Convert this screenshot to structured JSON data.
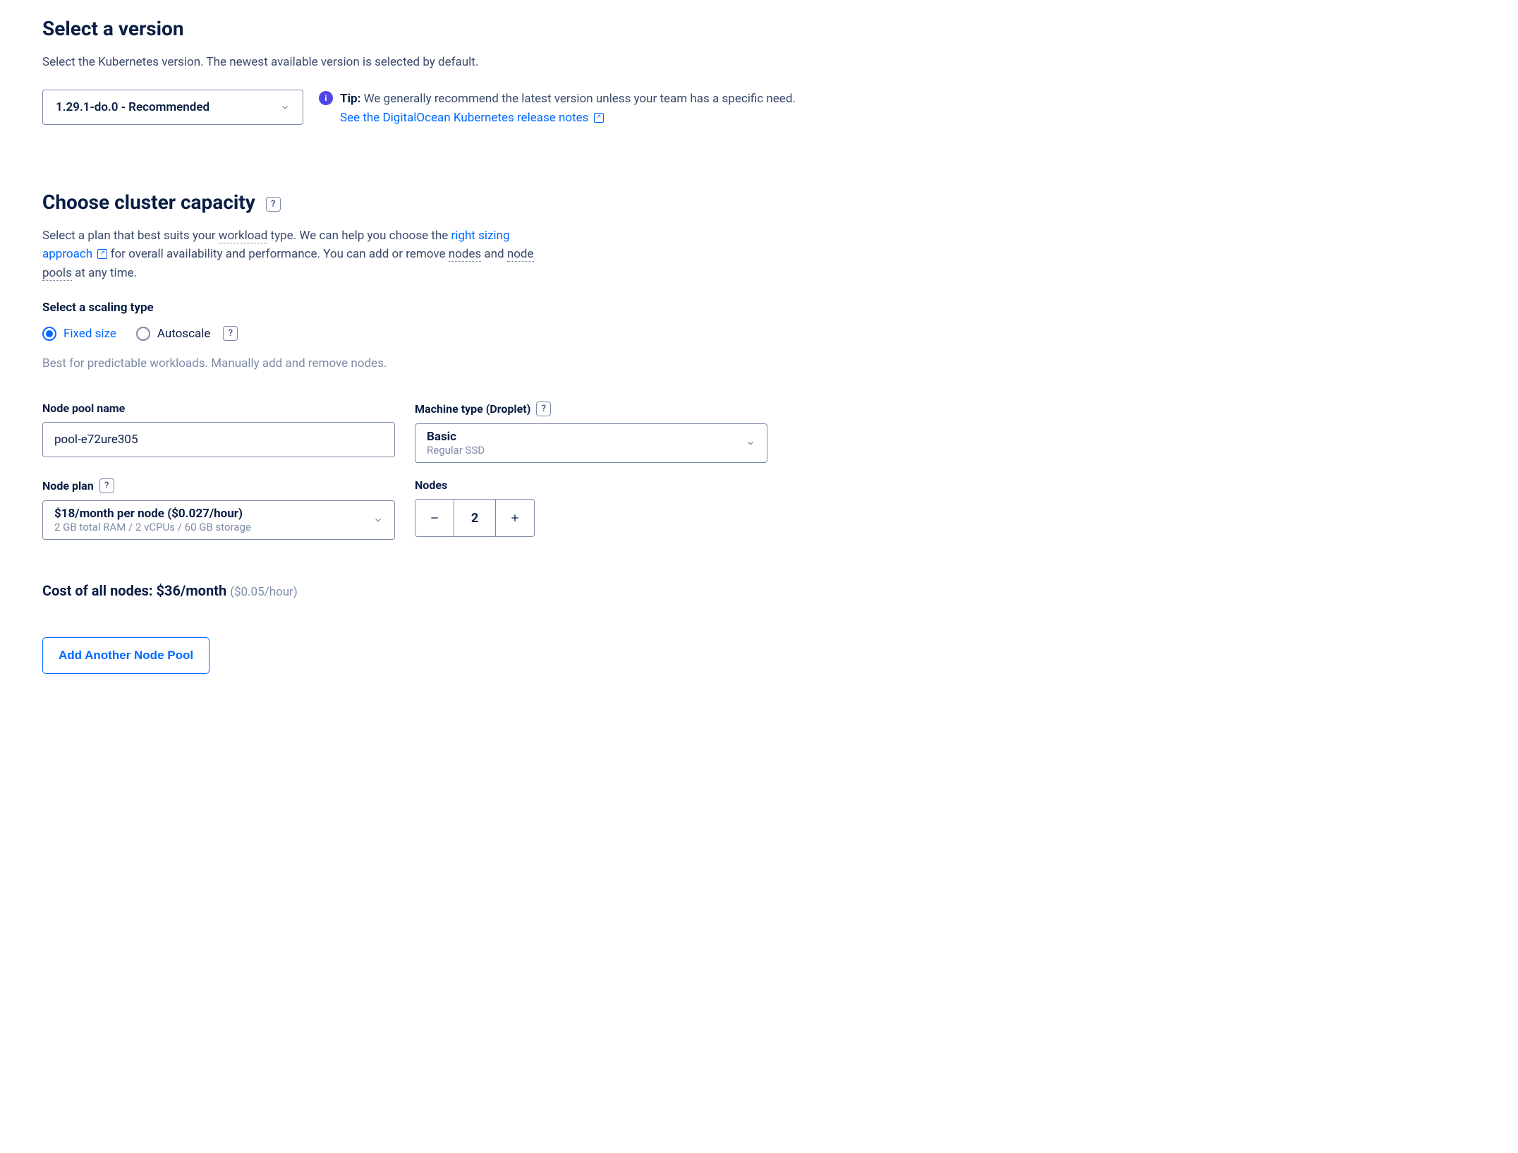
{
  "version": {
    "title": "Select a version",
    "subtitle": "Select the Kubernetes version. The newest available version is selected by default.",
    "selected": "1.29.1-do.0 - Recommended",
    "tip_label": "Tip:",
    "tip_text": "We generally recommend the latest version unless your team has a specific need.",
    "tip_link": "See the DigitalOcean Kubernetes release notes"
  },
  "capacity": {
    "title": "Choose cluster capacity",
    "desc_part1": "Select a plan that best suits your ",
    "desc_workload": "workload",
    "desc_part2": " type. We can help you choose the ",
    "desc_link": "right sizing approach",
    "desc_part3": " for overall availability and performance. You can add or remove ",
    "desc_nodes": "nodes",
    "desc_part4": " and ",
    "desc_pools": "node pools",
    "desc_part5": " at any time."
  },
  "scaling": {
    "label": "Select a scaling type",
    "fixed": "Fixed size",
    "autoscale": "Autoscale",
    "desc": "Best for predictable workloads. Manually add and remove nodes."
  },
  "pool": {
    "name_label": "Node pool name",
    "name_value": "pool-e72ure305",
    "machine_label": "Machine type (Droplet)",
    "machine_value": "Basic",
    "machine_sub": "Regular SSD",
    "plan_label": "Node plan",
    "plan_value": "$18/month per node ($0.027/hour)",
    "plan_sub": "2 GB total RAM / 2 vCPUs / 60 GB storage",
    "nodes_label": "Nodes",
    "nodes_value": "2"
  },
  "cost": {
    "label": "Cost of all nodes: $36/month",
    "hourly": "($0.05/hour)"
  },
  "add_pool": "Add Another Node Pool"
}
